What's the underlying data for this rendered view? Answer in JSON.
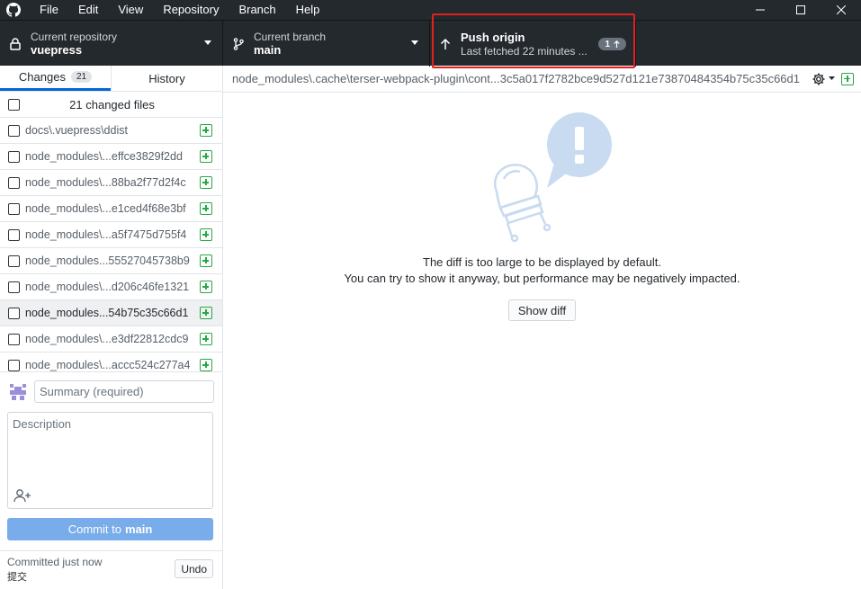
{
  "menu": [
    "File",
    "Edit",
    "View",
    "Repository",
    "Branch",
    "Help"
  ],
  "toolbar": {
    "repo_sub": "Current repository",
    "repo_name": "vuepress",
    "branch_sub": "Current branch",
    "branch_name": "main",
    "push_title": "Push origin",
    "push_sub": "Last fetched 22 minutes ...",
    "push_count": "1"
  },
  "tabs": {
    "changes_label": "Changes",
    "changes_count": "21",
    "history_label": "History"
  },
  "changes": {
    "header": "21 changed files",
    "files": [
      "docs\\.vuepress\\ddist",
      "node_modules\\...effce3829f2dd",
      "node_modules\\...88ba2f77d2f4c",
      "node_modules\\...e1ced4f68e3bf",
      "node_modules\\...a5f7475d755f4",
      "node_modules...55527045738b9",
      "node_modules\\...d206c46fe1321",
      "node_modules...54b75c35c66d1",
      "node_modules\\...e3df22812cdc9",
      "node_modules\\...accc524c277a4"
    ],
    "selected_index": 7
  },
  "commit": {
    "summary_placeholder": "Summary (required)",
    "description_placeholder": "Description",
    "button_prefix": "Commit to",
    "button_branch": "main"
  },
  "undo": {
    "status": "Committed just now",
    "message": "提交",
    "button": "Undo"
  },
  "diff": {
    "path": "node_modules\\.cache\\terser-webpack-plugin\\cont...3c5a017f2782bce9d527d121e73870484354b75c35c66d1",
    "line1": "The diff is too large to be displayed by default.",
    "line2": "You can try to show it anyway, but performance may be negatively impacted.",
    "show_button": "Show diff"
  },
  "colors": {
    "toolbar_bg": "#24292e",
    "accent": "#0366d6",
    "commit_btn": "#78acea",
    "added": "#28a745",
    "highlight": "#e0211e"
  }
}
